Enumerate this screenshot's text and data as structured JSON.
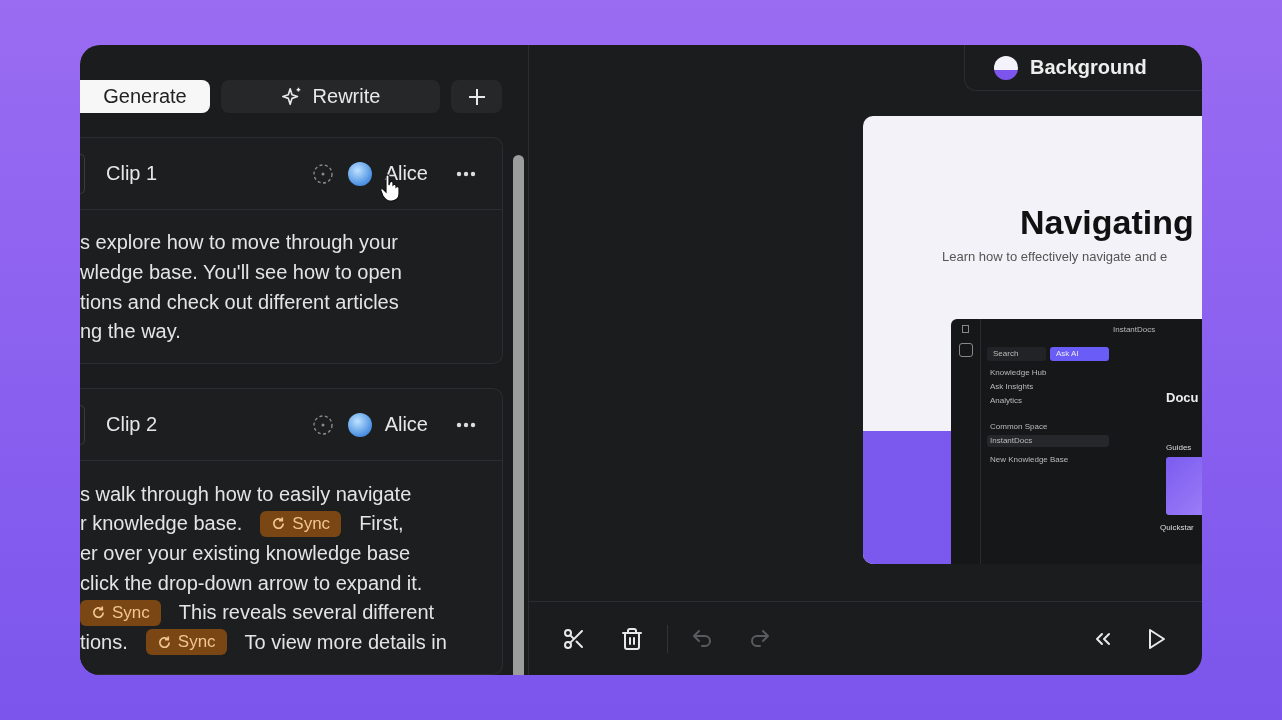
{
  "background_chip": {
    "label": "Background"
  },
  "actions": [
    {
      "kind": "plain",
      "label": "Generate",
      "selected": true
    },
    {
      "kind": "sparkle",
      "label": "Rewrite",
      "selected": false
    },
    {
      "kind": "add",
      "selected": false
    }
  ],
  "clips": [
    {
      "title": "Clip 1",
      "voice": "Alice",
      "hovered": true,
      "lines": [
        [
          {
            "kind": "text",
            "text": "s explore how to move through your"
          }
        ],
        [
          {
            "kind": "text",
            "text": "wledge base. You'll see how to open"
          }
        ],
        [
          {
            "kind": "text",
            "text": "tions and check out different articles"
          }
        ],
        [
          {
            "kind": "text",
            "text": "ng the way."
          }
        ]
      ]
    },
    {
      "title": "Clip 2",
      "voice": "Alice",
      "hovered": false,
      "lines": [
        [
          {
            "kind": "text",
            "text": "s walk through how to easily navigate"
          }
        ],
        [
          {
            "kind": "text",
            "text": "r knowledge base."
          },
          {
            "kind": "sync",
            "text": "Sync"
          },
          {
            "kind": "text",
            "text": "First,"
          }
        ],
        [
          {
            "kind": "text",
            "text": "er over your existing knowledge base"
          }
        ],
        [
          {
            "kind": "text",
            "text": "click the drop-down arrow to expand it."
          }
        ],
        [
          {
            "kind": "sync",
            "text": "Sync"
          },
          {
            "kind": "text",
            "text": "This reveals several different"
          }
        ],
        [
          {
            "kind": "text",
            "text": "tions."
          },
          {
            "kind": "sync",
            "text": "Sync"
          },
          {
            "kind": "text",
            "text": "To view more details in"
          }
        ]
      ]
    }
  ],
  "preview": {
    "title": "Navigating",
    "subtitle": "Learn how to effectively navigate and e",
    "embedded": {
      "breadcrumb": "InstantDocs",
      "search": "Search",
      "ask": "Ask AI",
      "nav": [
        "Knowledge Hub",
        "Ask Insights",
        "Analytics"
      ],
      "bases": [
        {
          "label": "Common Space",
          "selected": false
        },
        {
          "label": "InstantDocs",
          "selected": true
        }
      ],
      "new_base": "New Knowledge Base",
      "heading": "Docu",
      "guides": "Guides",
      "guide_title": "Quickstar"
    }
  },
  "toolbar": {
    "edit": [
      {
        "kind": "cut",
        "disabled": false
      },
      {
        "kind": "delete",
        "disabled": false
      }
    ],
    "history": [
      {
        "kind": "undo",
        "disabled": true
      },
      {
        "kind": "redo",
        "disabled": true
      }
    ],
    "playback": [
      {
        "kind": "rewind",
        "disabled": false
      },
      {
        "kind": "play",
        "disabled": false
      }
    ]
  }
}
